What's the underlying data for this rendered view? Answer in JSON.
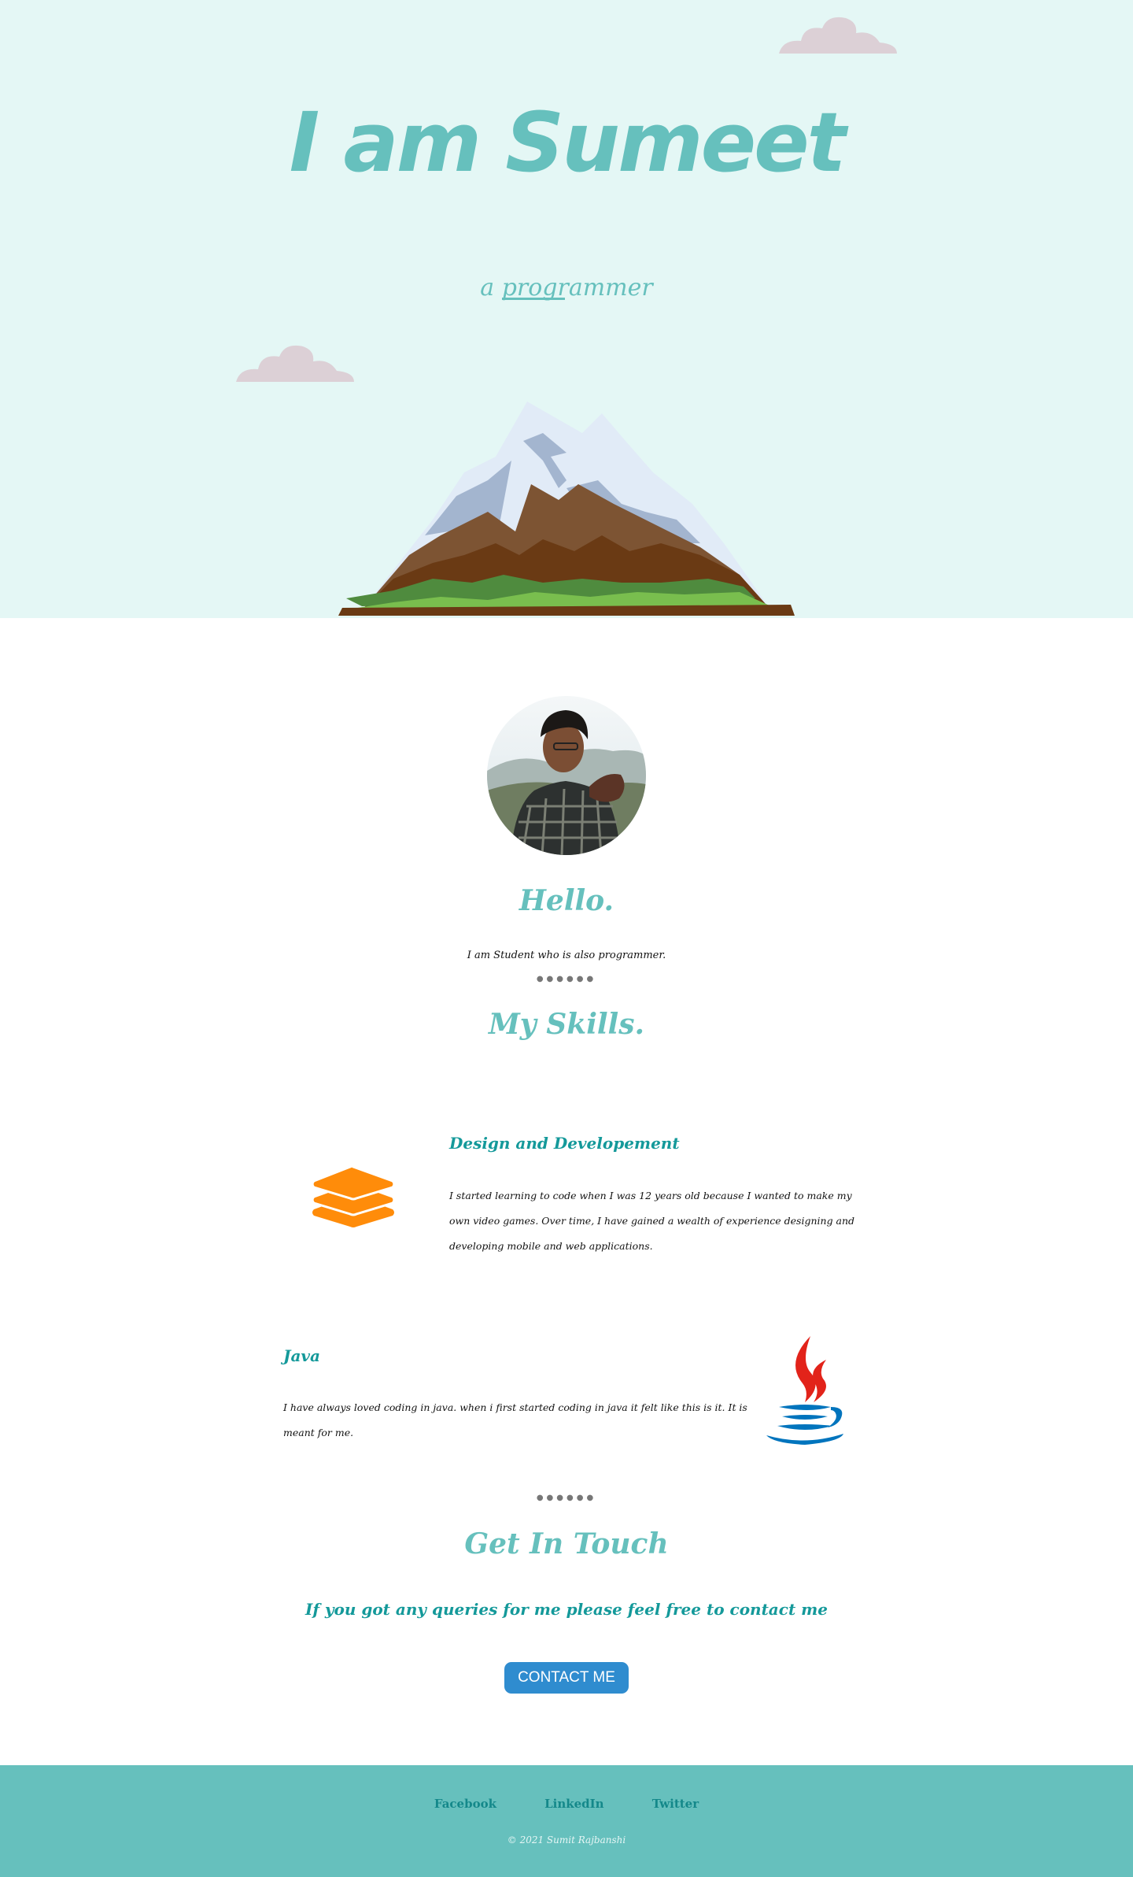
{
  "hero": {
    "title": "I am Sumeet",
    "subtitle_prefix": "a ",
    "subtitle_word": "programmer",
    "background": "#e4f7f5",
    "accent": "#66c0bd"
  },
  "about": {
    "avatar_alt": "profile-photo",
    "greeting": "Hello.",
    "text": "I am Student who is also programmer.",
    "dots": "●●●●●●"
  },
  "skills": {
    "heading": "My Skills.",
    "items": [
      {
        "title": "Design and Developement",
        "text": "I started learning to code when I was 12 years old because I wanted to make my own video games. Over time, I have gained a wealth of experience designing and developing mobile and web applications.",
        "icon": "layers-icon",
        "icon_color": "#ff8c0a"
      },
      {
        "title": "Java",
        "text": "I have always loved coding in java. when i first started coding in java it felt like this is it. It is meant for me.",
        "icon": "java-icon"
      }
    ],
    "dots": "●●●●●●"
  },
  "contact": {
    "heading": "Get In Touch",
    "subtitle": "If you got any queries for me please feel free to contact me",
    "button_label": "CONTACT ME",
    "button_color": "#2f8ccf"
  },
  "footer": {
    "links": [
      "Facebook",
      "LinkedIn",
      "Twitter"
    ],
    "copyright": "© 2021 Sumit Rajbanshi",
    "background": "#66c0bd"
  }
}
